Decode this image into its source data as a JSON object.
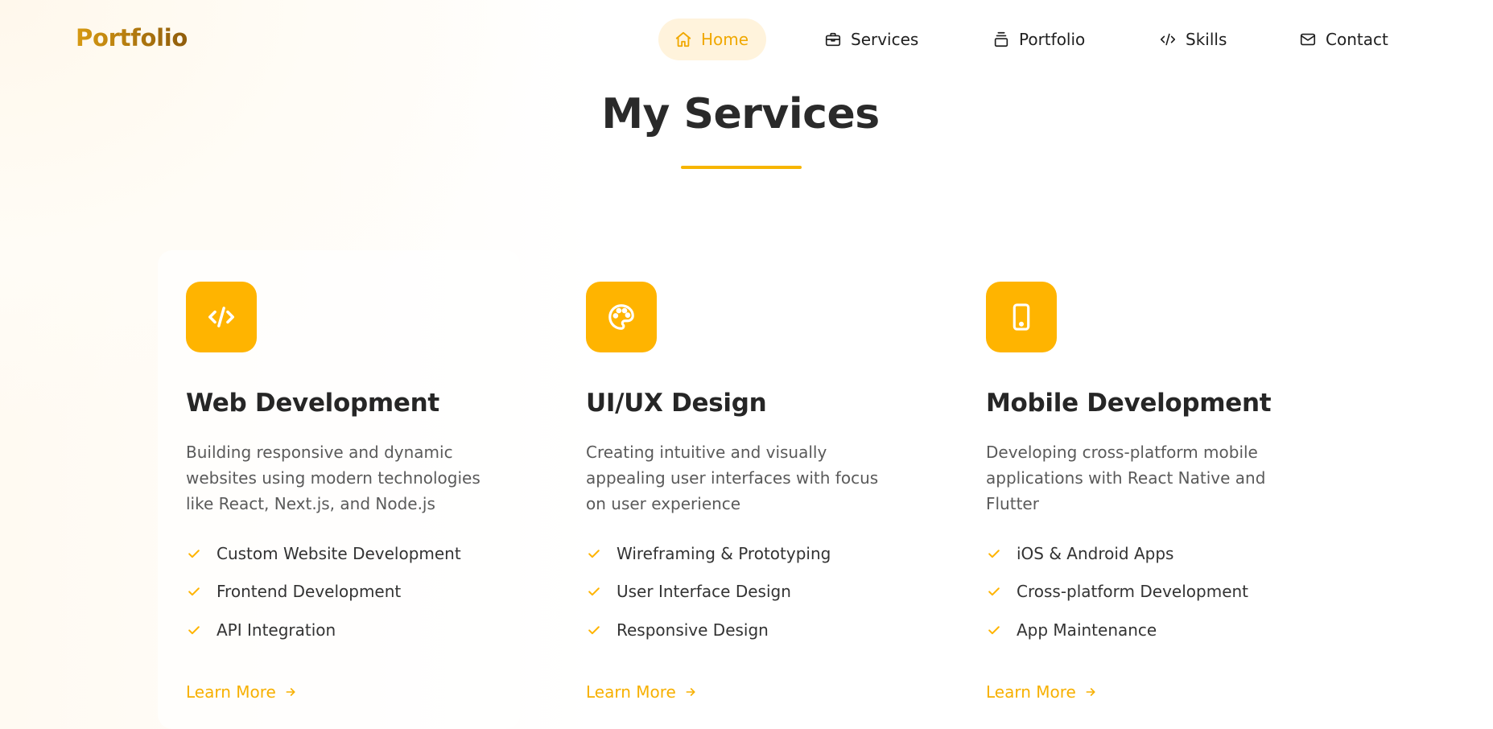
{
  "brand": {
    "logo_text": "Portfolio"
  },
  "nav": {
    "items": [
      {
        "label": "Home",
        "icon": "home-icon",
        "active": true
      },
      {
        "label": "Services",
        "icon": "briefcase-icon"
      },
      {
        "label": "Portfolio",
        "icon": "layers-icon"
      },
      {
        "label": "Skills",
        "icon": "code-icon"
      },
      {
        "label": "Contact",
        "icon": "mail-icon"
      }
    ]
  },
  "section": {
    "title": "My Services"
  },
  "services": [
    {
      "icon": "code-icon",
      "title": "Web Development",
      "description": "Building responsive and dynamic websites using modern technologies like React, Next.js, and Node.js",
      "features": [
        "Custom Website Development",
        "Frontend Development",
        "API Integration"
      ],
      "link_label": "Learn More"
    },
    {
      "icon": "palette-icon",
      "title": "UI/UX Design",
      "description": "Creating intuitive and visually appealing user interfaces with focus on user experience",
      "features": [
        "Wireframing & Prototyping",
        "User Interface Design",
        "Responsive Design"
      ],
      "link_label": "Learn More"
    },
    {
      "icon": "smartphone-icon",
      "title": "Mobile Development",
      "description": "Developing cross-platform mobile applications with React Native and Flutter",
      "features": [
        "iOS & Android Apps",
        "Cross-platform Development",
        "App Maintenance"
      ],
      "link_label": "Learn More"
    }
  ],
  "colors": {
    "accent": "#ffb400",
    "accent_text": "#f7b000",
    "active_nav_bg": "#fff3dc",
    "heading": "#2a2a2a",
    "body_text": "#5a5a5a"
  }
}
